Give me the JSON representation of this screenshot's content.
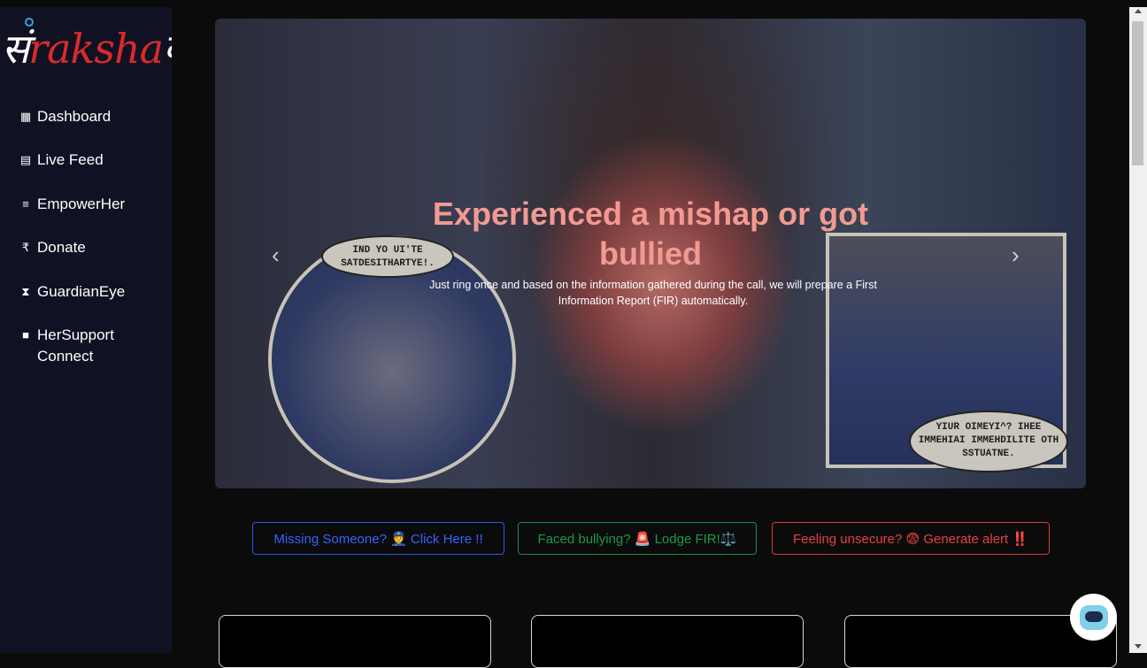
{
  "brand": {
    "logo_pre": "सं",
    "logo_mid": "raksha",
    "logo_post": "क"
  },
  "sidebar": {
    "items": [
      {
        "label": "Dashboard",
        "icon": "grid-icon",
        "glyph": "▦"
      },
      {
        "label": "Live Feed",
        "icon": "newspaper-icon",
        "glyph": "▤"
      },
      {
        "label": "EmpowerHer",
        "icon": "list-icon",
        "glyph": "≡"
      },
      {
        "label": "Donate",
        "icon": "rupee-icon",
        "glyph": "₹"
      },
      {
        "label": "GuardianEye",
        "icon": "hourglass-icon",
        "glyph": "⧗"
      },
      {
        "label": "HerSupport Connect",
        "icon": "video-camera-icon",
        "glyph": "■"
      }
    ]
  },
  "hero": {
    "title": "Experienced a mishap or got bullied",
    "subtitle": "Just ring once and based on the information gathered during the call, we will prepare a First Information Report (FIR) automatically.",
    "speech_left": "IND YO UI'TE SATDESITHARTYE!.",
    "speech_right": "YIUR OIMEYI^? IHEE IMMEHIAI IMMEHDILITE OTH SSTUATNE.",
    "prev_arrow": "‹",
    "next_arrow": "›"
  },
  "actions": {
    "missing": "Missing Someone? 👮 Click Here !!",
    "bullying": "Faced bullying? 🚨 Lodge FIR!⚖️",
    "unsecure": "Feeling unsecure? 😨 Generate alert ‼️"
  },
  "colors": {
    "sidebar_bg": "#101223",
    "blue": "#3563ff",
    "green": "#1c9a47",
    "red": "#e5413f",
    "hero_title": "#f29a92"
  }
}
